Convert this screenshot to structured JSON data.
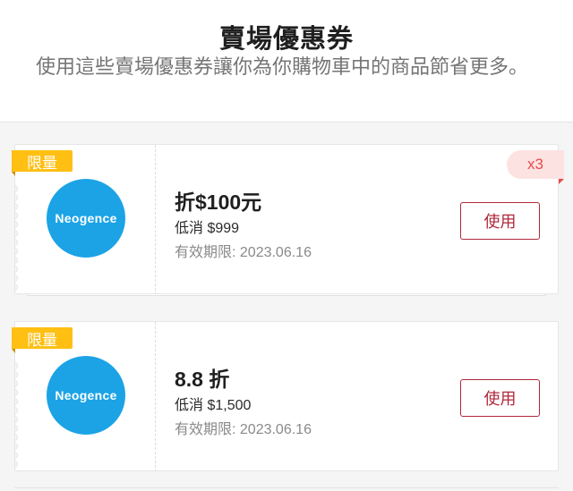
{
  "header": {
    "title": "賣場優惠券",
    "subtitle": "使用這些賣場優惠券讓你為你購物車中的商品節省更多。"
  },
  "coupons": [
    {
      "badge": "限量",
      "brand": "Neogence",
      "discount": "折$100元",
      "min_spend": "低消 $999",
      "expiry": "有效期限: 2023.06.16",
      "use_label": "使用",
      "quantity": "x3"
    },
    {
      "badge": "限量",
      "brand": "Neogence",
      "discount": "8.8 折",
      "min_spend": "低消 $1,500",
      "expiry": "有效期限: 2023.06.16",
      "use_label": "使用"
    }
  ],
  "colors": {
    "brand_blue": "#1ba3e6",
    "badge_yellow": "#ffbf13",
    "accent_red": "#b0283b",
    "qty_pink": "#fde2e2"
  }
}
